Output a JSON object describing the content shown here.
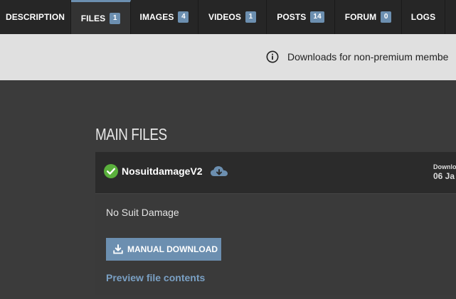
{
  "tabs": [
    {
      "label": "Description",
      "count": null
    },
    {
      "label": "Files",
      "count": "1"
    },
    {
      "label": "Images",
      "count": "4"
    },
    {
      "label": "Videos",
      "count": "1"
    },
    {
      "label": "Posts",
      "count": "14"
    },
    {
      "label": "Forum",
      "count": "0"
    },
    {
      "label": "Logs",
      "count": null
    }
  ],
  "notice": {
    "text": "Downloads for non-premium membe"
  },
  "main": {
    "section_title": "MAIN FILES",
    "file": {
      "name": "NosuitdamageV2",
      "date_label": "Downlo",
      "date_value": "06 Ja",
      "description": "No Suit Damage",
      "download_label": "MANUAL DOWNLOAD",
      "preview_label": "Preview file contents"
    }
  },
  "colors": {
    "accent": "#6c8fb0",
    "success": "#5ab03c",
    "link": "#7aa0c4"
  },
  "icons": {
    "info": "info-circle-icon",
    "check": "check-circle-icon",
    "cloud": "cloud-download-icon",
    "download": "download-icon"
  }
}
